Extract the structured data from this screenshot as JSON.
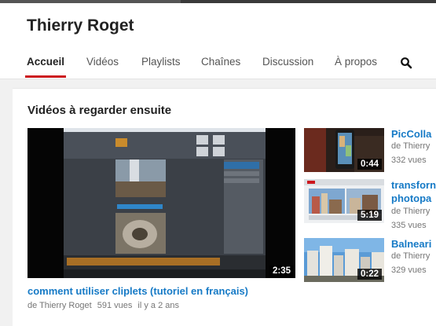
{
  "channel": {
    "name": "Thierry Roget"
  },
  "tabs": [
    {
      "label": "Accueil",
      "active": true
    },
    {
      "label": "Vidéos"
    },
    {
      "label": "Playlists"
    },
    {
      "label": "Chaînes"
    },
    {
      "label": "Discussion"
    },
    {
      "label": "À propos"
    }
  ],
  "search": {
    "icon": "search-icon"
  },
  "section": {
    "title": "Vidéos à regarder ensuite"
  },
  "main_video": {
    "duration": "2:35",
    "title": "comment utiliser cliplets (tutoriel en français)",
    "author": "de Thierry Roget",
    "views": "591 vues",
    "age": "il y a 2 ans"
  },
  "side_videos": [
    {
      "title_lines": [
        "PicColla"
      ],
      "duration": "0:44",
      "author": "de Thierry",
      "views": "332 vues"
    },
    {
      "title_lines": [
        "transforn",
        "photopa"
      ],
      "duration": "5:19",
      "author": "de Thierry",
      "views": "335 vues"
    },
    {
      "title_lines": [
        "Balneari"
      ],
      "duration": "0:22",
      "author": "de Thierry",
      "views": "329 vues"
    }
  ],
  "colors": {
    "accent": "#cc181e",
    "link": "#167ac6",
    "meta": "#767676"
  }
}
